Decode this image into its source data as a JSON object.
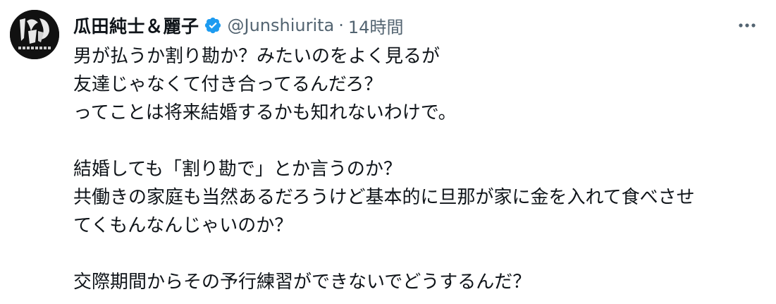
{
  "author": {
    "display_name": "瓜田純士＆麗子",
    "handle": "@Junshiurita",
    "separator": "·",
    "time": "14時間",
    "avatar_icon": "profile-avatar",
    "verified_icon": "verified-badge-icon",
    "verified_color": "#1d9bf0"
  },
  "menu": {
    "icon": "more-horizontal-icon"
  },
  "tweet": {
    "lines": [
      "男が払うか割り勘か？みたいのをよく見るが",
      "友達じゃなくて付き合ってるんだろ？",
      "ってことは将来結婚するかも知れないわけで。",
      "",
      "結婚しても「割り勘で」とか言うのか？",
      "共働きの家庭も当然あるだろうけど基本的に旦那が家に金を入れて食べさせ",
      "てくもんなんじゃいのか？",
      "",
      "交際期間からその予行練習ができないでどうするんだ？"
    ]
  },
  "colors": {
    "text": "#0f1419",
    "secondary": "#536471",
    "background": "#ffffff"
  }
}
